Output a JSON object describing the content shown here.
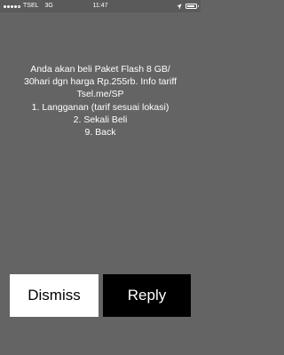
{
  "status_bar": {
    "carrier": "TSEL",
    "network": "3G",
    "time": "11:47",
    "signal_strength": 4,
    "signal_max": 5,
    "battery_level": 0.85
  },
  "message": {
    "lines": [
      "Anda akan beli Paket Flash 8 GB/",
      "30hari dgn harga Rp.255rb. Info tariff",
      "Tsel.me/SP",
      "1. Langganan (tarif sesuai lokasi)",
      "2. Sekali Beli",
      "9. Back"
    ]
  },
  "buttons": {
    "dismiss_label": "Dismiss",
    "reply_label": "Reply"
  },
  "colors": {
    "background": "#646464",
    "text": "#ffffff",
    "dismiss_bg": "#ffffff",
    "reply_bg": "#000000"
  }
}
